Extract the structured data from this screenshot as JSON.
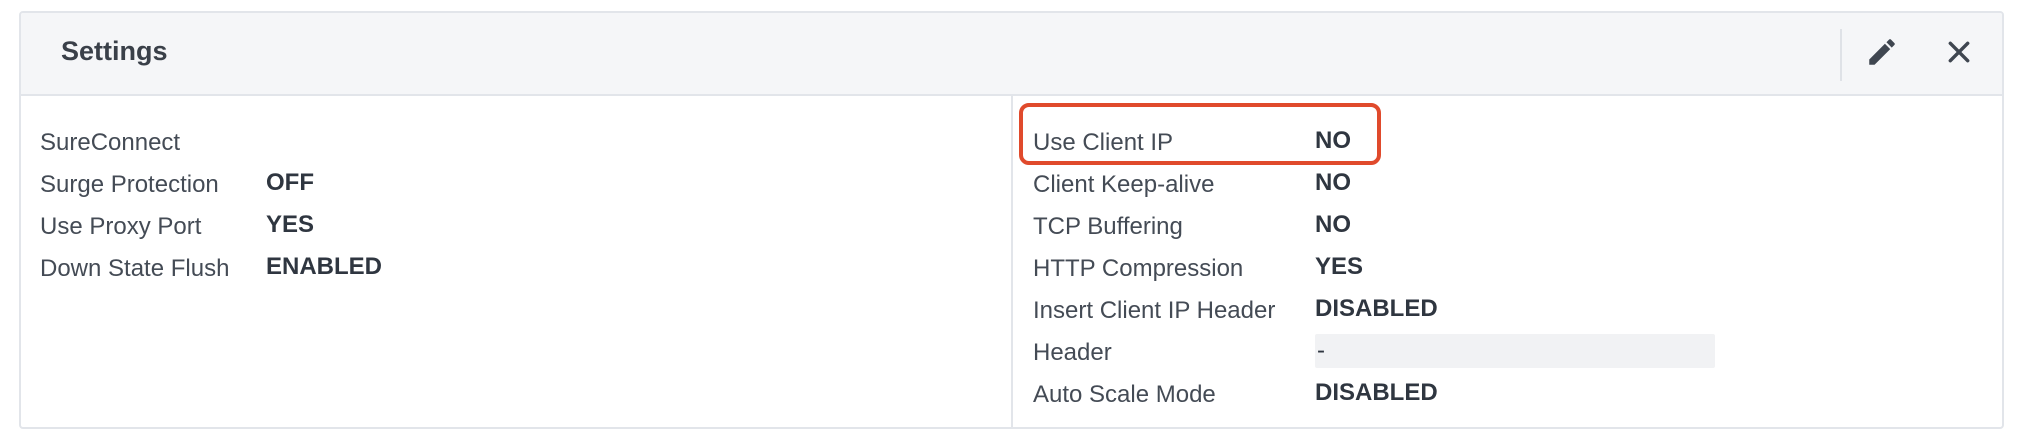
{
  "panel": {
    "title": "Settings",
    "edit_icon": "pencil-icon",
    "close_icon": "close-icon"
  },
  "left_settings": [
    {
      "label": "SureConnect",
      "value": ""
    },
    {
      "label": "Surge Protection",
      "value": "OFF"
    },
    {
      "label": "Use Proxy Port",
      "value": "YES"
    },
    {
      "label": "Down State Flush",
      "value": "ENABLED"
    }
  ],
  "right_settings": [
    {
      "label": "Use Client IP",
      "value": "NO"
    },
    {
      "label": "Client Keep-alive",
      "value": "NO"
    },
    {
      "label": "TCP Buffering",
      "value": "NO"
    },
    {
      "label": "HTTP Compression",
      "value": "YES"
    },
    {
      "label": "Insert Client IP Header",
      "value": "DISABLED"
    },
    {
      "label": "Header",
      "value": "-"
    },
    {
      "label": "Auto Scale Mode",
      "value": "DISABLED"
    }
  ],
  "colors": {
    "highlight": "#e04a2c",
    "header_bg": "#f5f6f8",
    "border": "#e2e5ea"
  }
}
